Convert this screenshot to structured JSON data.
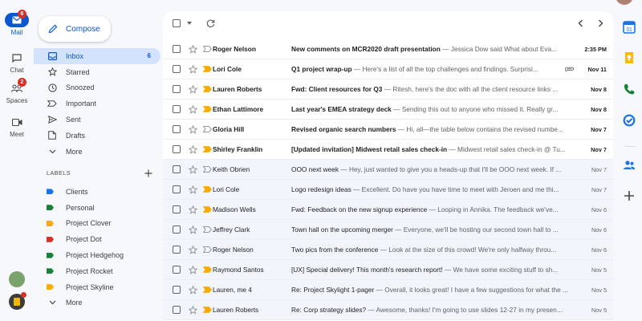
{
  "app": {
    "accent": "#0b57d0",
    "badge_color": "#d93025"
  },
  "rail": [
    {
      "label": "Mail",
      "icon": "mail-icon",
      "badge": "6"
    },
    {
      "label": "Chat",
      "icon": "chat-icon",
      "badge": ""
    },
    {
      "label": "Spaces",
      "icon": "spaces-icon",
      "badge": "2"
    },
    {
      "label": "Meet",
      "icon": "meet-icon",
      "badge": ""
    }
  ],
  "compose": {
    "label": "Compose"
  },
  "nav": [
    {
      "label": "Inbox",
      "icon": "inbox-icon",
      "count": "6"
    },
    {
      "label": "Starred",
      "icon": "star-icon",
      "count": ""
    },
    {
      "label": "Snoozed",
      "icon": "clock-icon",
      "count": ""
    },
    {
      "label": "Important",
      "icon": "important-icon",
      "count": ""
    },
    {
      "label": "Sent",
      "icon": "send-icon",
      "count": ""
    },
    {
      "label": "Drafts",
      "icon": "draft-icon",
      "count": ""
    },
    {
      "label": "More",
      "icon": "chevron-down-icon",
      "count": ""
    }
  ],
  "labels": {
    "heading": "LABELS",
    "items": [
      {
        "label": "Clients",
        "color": "#1a73e8"
      },
      {
        "label": "Personal",
        "color": "#188038"
      },
      {
        "label": "Project Clover",
        "color": "#f9ab00"
      },
      {
        "label": "Project Dot",
        "color": "#d93025"
      },
      {
        "label": "Project Hedgehog",
        "color": "#188038"
      },
      {
        "label": "Project Rocket",
        "color": "#188038"
      },
      {
        "label": "Project Skyline",
        "color": "#f9ab00"
      }
    ],
    "more": "More"
  },
  "emails": [
    {
      "sender": "Roger Nelson",
      "subject": "New comments on MCR2020 draft presentation",
      "snippet": "Jessica Dow said What about Eva...",
      "date": "2:35 PM",
      "unread": true,
      "important": false,
      "attachment": false
    },
    {
      "sender": "Lori Cole",
      "subject": "Q1 project wrap-up",
      "snippet": "Here's a list of all the top challenges and findings. Surprisi...",
      "date": "Nov 11",
      "unread": true,
      "important": true,
      "attachment": true
    },
    {
      "sender": "Lauren Roberts",
      "subject": "Fwd: Client resources for Q3",
      "snippet": "Ritesh, here's the doc with all the client resource links ...",
      "date": "Nov 8",
      "unread": true,
      "important": true,
      "attachment": false
    },
    {
      "sender": "Ethan Lattimore",
      "subject": "Last year's EMEA strategy deck",
      "snippet": "Sending this out to anyone who missed it. Really gr...",
      "date": "Nov 8",
      "unread": true,
      "important": true,
      "attachment": false
    },
    {
      "sender": "Gloria Hill",
      "subject": "Revised organic search numbers",
      "snippet": "Hi, all—the table below contains the revised numbe...",
      "date": "Nov 7",
      "unread": true,
      "important": false,
      "attachment": false
    },
    {
      "sender": "Shirley Franklin",
      "subject": "[Updated invitation] Midwest retail sales check-in",
      "snippet": "Midwest retail sales check-in @ Tu...",
      "date": "Nov 7",
      "unread": true,
      "important": true,
      "attachment": false
    },
    {
      "sender": "Keith Obrien",
      "subject": "OOO next week",
      "snippet": "Hey, just wanted to give you a heads-up that I'll be OOO next week. If ...",
      "date": "Nov 7",
      "unread": false,
      "important": false,
      "attachment": false
    },
    {
      "sender": "Lori Cole",
      "subject": "Logo redesign ideas",
      "snippet": "Excellent. Do have you have time to meet with Jeroen and me thi...",
      "date": "Nov 7",
      "unread": false,
      "important": true,
      "attachment": false
    },
    {
      "sender": "Madison Wells",
      "subject": "Fwd: Feedback on the new signup experience",
      "snippet": "Looping in Annika. The feedback we've...",
      "date": "Nov 6",
      "unread": false,
      "important": true,
      "attachment": false
    },
    {
      "sender": "Jeffrey Clark",
      "subject": "Town hall on the upcoming merger",
      "snippet": "Everyone, we'll be hosting our second town hall to ...",
      "date": "Nov 6",
      "unread": false,
      "important": false,
      "attachment": false
    },
    {
      "sender": "Roger Nelson",
      "subject": "Two pics from the conference",
      "snippet": "Look at the size of this crowd! We're only halfway throu...",
      "date": "Nov 6",
      "unread": false,
      "important": false,
      "attachment": false
    },
    {
      "sender": "Raymond Santos",
      "subject": "[UX] Special delivery! This month's research report!",
      "snippet": "We have some exciting stuff to sh...",
      "date": "Nov 5",
      "unread": false,
      "important": true,
      "attachment": false
    },
    {
      "sender": "Lauren, me 4",
      "subject": "Re: Project Skylight 1-pager",
      "snippet": "Overall, it looks great! I have a few suggestions for what the ...",
      "date": "Nov 5",
      "unread": false,
      "important": true,
      "attachment": false
    },
    {
      "sender": "Lauren Roberts",
      "subject": "Re: Corp strategy slides?",
      "snippet": "Awesome, thanks! I'm going to use slides 12-27 in my presen...",
      "date": "Nov 5",
      "unread": false,
      "important": true,
      "attachment": false
    }
  ],
  "right_rail": [
    {
      "icon": "calendar-icon"
    },
    {
      "icon": "keep-icon"
    },
    {
      "icon": "voice-icon"
    },
    {
      "icon": "tasks-icon"
    },
    {
      "icon": "contacts-icon"
    },
    {
      "icon": "add-icon"
    }
  ]
}
